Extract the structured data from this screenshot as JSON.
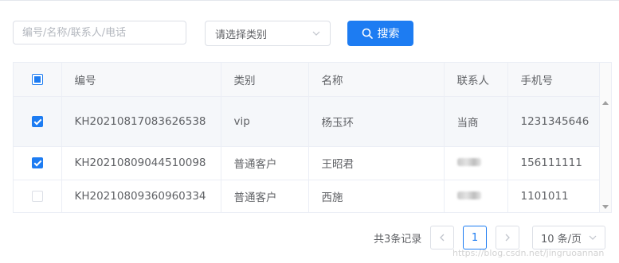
{
  "search": {
    "placeholder": "编号/名称/联系人/电话",
    "category_placeholder": "请选择类别",
    "button_label": "搜索"
  },
  "table": {
    "columns": [
      "编号",
      "类别",
      "名称",
      "联系人",
      "手机号"
    ],
    "rows": [
      {
        "checked": true,
        "id": "KH20210817083626538",
        "category": "vip",
        "name": "杨玉环",
        "contact": "当商",
        "phone": "1231345646"
      },
      {
        "checked": true,
        "id": "KH20210809044510098",
        "category": "普通客户",
        "name": "王昭君",
        "contact": "",
        "phone": "156111111"
      },
      {
        "checked": false,
        "id": "KH20210809360960334",
        "category": "普通客户",
        "name": "西施",
        "contact": "",
        "phone": "1101011"
      }
    ]
  },
  "pagination": {
    "total": "共3条记录",
    "current_page": "1",
    "page_size": "10 条/页"
  },
  "watermark": "https://blog.csdn.net/jingruoannan",
  "colors": {
    "accent": "#1d7cf2"
  }
}
